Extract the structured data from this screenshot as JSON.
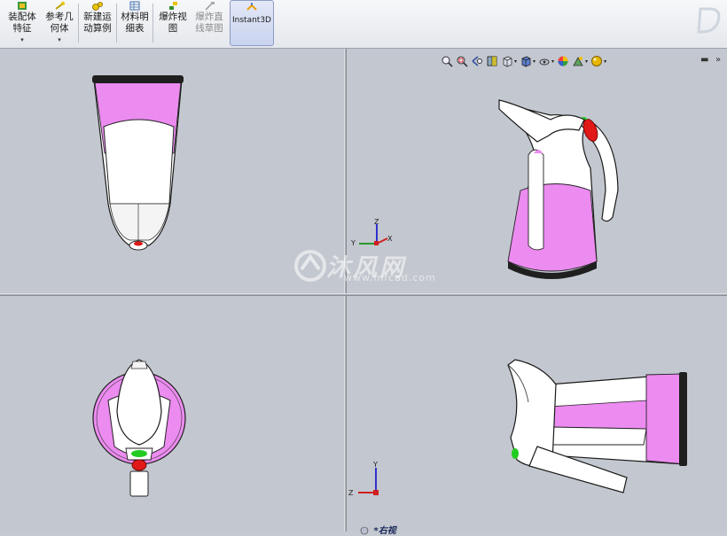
{
  "toolbar": {
    "buttons": [
      {
        "id": "assembly",
        "line1": "装配体",
        "line2": "特征",
        "dropdown": "▾"
      },
      {
        "id": "refgeom",
        "line1": "参考几",
        "line2": "何体",
        "dropdown": "▾"
      },
      {
        "id": "motion",
        "line1": "新建运",
        "line2": "动算例"
      },
      {
        "id": "bom",
        "line1": "材料明",
        "line2": "细表"
      },
      {
        "id": "explode",
        "line1": "爆炸视",
        "line2": "图"
      },
      {
        "id": "explodeline",
        "line1": "爆炸直",
        "line2": "线草图",
        "disabled": true
      },
      {
        "id": "instant3d",
        "line1": "Instant3D",
        "line2": ""
      }
    ]
  },
  "view_toolbar": {
    "icons": [
      "zoom-to-fit-icon",
      "zoom-area-icon",
      "previous-view-icon",
      "section-view-icon",
      "view-orientation-icon",
      "display-style-icon",
      "hide-show-icon",
      "edit-appearance-icon",
      "apply-scene-icon",
      "view-settings-icon"
    ]
  },
  "watermark": {
    "brand": "沐风网",
    "url": "www.mfcad.com"
  },
  "views": {
    "bottom_right_label": "*右视"
  },
  "triad": {
    "x": "X",
    "y": "Y",
    "z": "Z"
  },
  "colors": {
    "pink": "#ec8bf0",
    "dark": "#222222",
    "red": "#e01818",
    "green": "#22cc22",
    "background": "#c3c7cf"
  }
}
